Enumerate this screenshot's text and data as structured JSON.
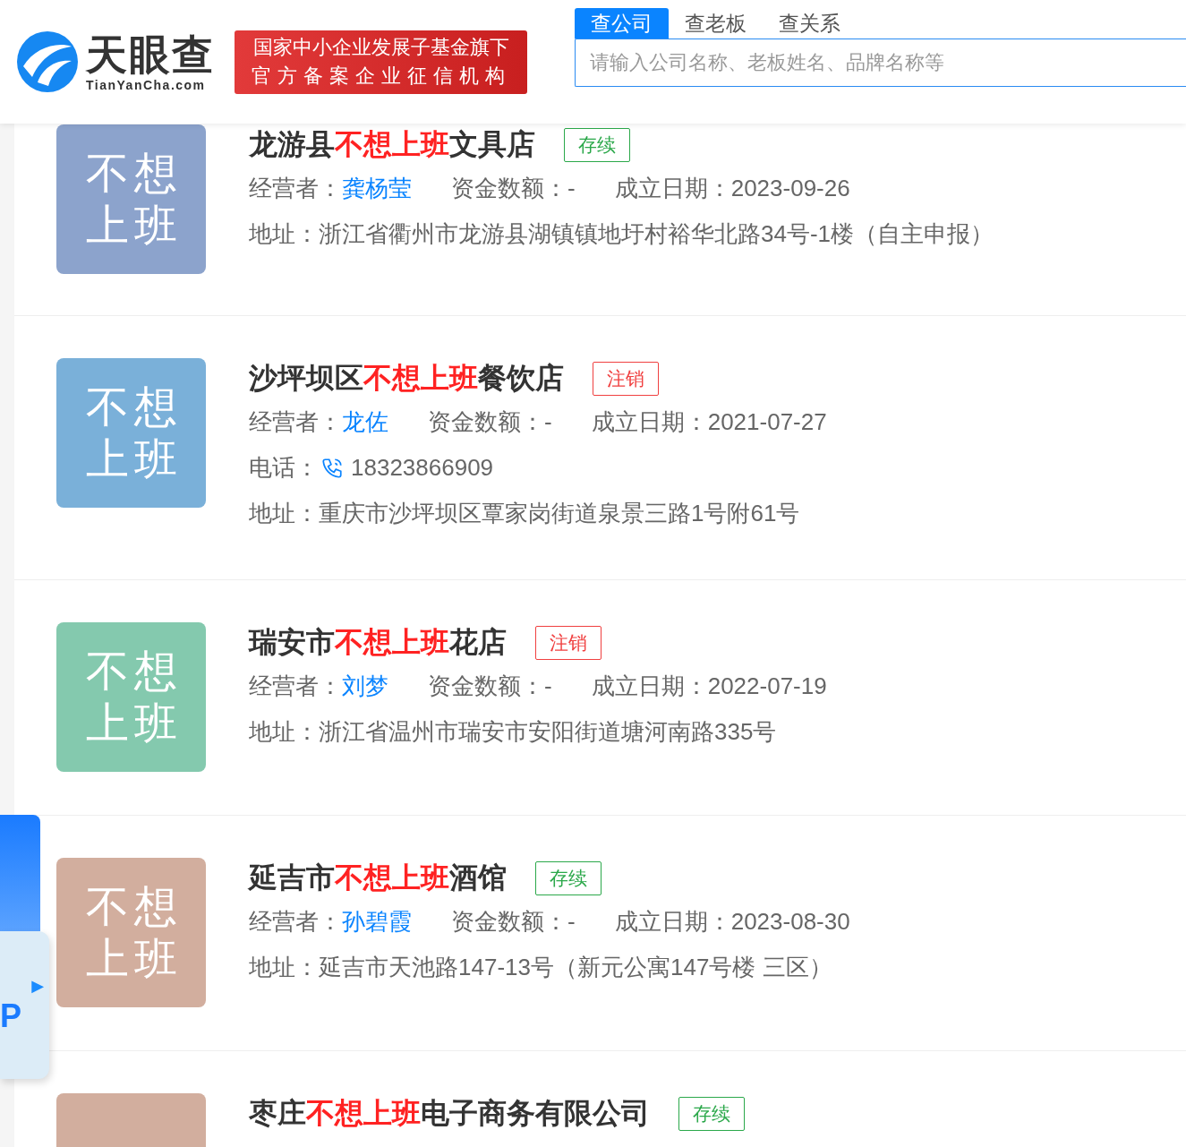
{
  "header": {
    "brand": "天眼查",
    "domain": "TianYanCha.com",
    "badge_lines": [
      "国家中小企业发展子基金旗下",
      "官方备案企业征信机构"
    ],
    "search_tabs": [
      {
        "label": "查公司",
        "selected": true
      },
      {
        "label": "查老板",
        "selected": false
      },
      {
        "label": "查关系",
        "selected": false
      }
    ],
    "search": {
      "placeholder": "请输入公司名称、老板姓名、品牌名称等"
    }
  },
  "results": [
    {
      "logo": [
        "不想",
        "上班"
      ],
      "color": "#8ca3cc",
      "name_prefix": "龙游县",
      "name_highlight": "不想上班",
      "name_suffix": "文具店",
      "status": {
        "label": "存续",
        "kind": "active"
      },
      "fields": [
        {
          "label": "经营者：",
          "value": "龚杨莹",
          "kind": "link"
        },
        {
          "label": "资金数额：",
          "value": "-",
          "kind": "plain"
        },
        {
          "label": "成立日期：",
          "value": "2023-09-26",
          "kind": "plain"
        }
      ],
      "lines": [
        {
          "label": "地址：",
          "value": "浙江省衢州市龙游县湖镇镇地圩村裕华北路34号-1楼（自主申报）",
          "kind": "address"
        }
      ]
    },
    {
      "logo": [
        "不想",
        "上班"
      ],
      "color": "#7ab0d9",
      "name_prefix": "沙坪坝区",
      "name_highlight": "不想上班",
      "name_suffix": "餐饮店",
      "status": {
        "label": "注销",
        "kind": "cancelled"
      },
      "fields": [
        {
          "label": "经营者：",
          "value": "龙佐",
          "kind": "link"
        },
        {
          "label": "资金数额：",
          "value": "-",
          "kind": "plain"
        },
        {
          "label": "成立日期：",
          "value": "2021-07-27",
          "kind": "plain"
        }
      ],
      "lines": [
        {
          "label": "电话：",
          "value": "18323866909",
          "kind": "phone"
        },
        {
          "label": "地址：",
          "value": "重庆市沙坪坝区覃家岗街道泉景三路1号附61号",
          "kind": "address"
        }
      ]
    },
    {
      "logo": [
        "不想",
        "上班"
      ],
      "color": "#84c9ae",
      "name_prefix": "瑞安市",
      "name_highlight": "不想上班",
      "name_suffix": "花店",
      "status": {
        "label": "注销",
        "kind": "cancelled"
      },
      "fields": [
        {
          "label": "经营者：",
          "value": "刘梦",
          "kind": "link"
        },
        {
          "label": "资金数额：",
          "value": "-",
          "kind": "plain"
        },
        {
          "label": "成立日期：",
          "value": "2022-07-19",
          "kind": "plain"
        }
      ],
      "lines": [
        {
          "label": "地址：",
          "value": "浙江省温州市瑞安市安阳街道塘河南路335号",
          "kind": "address"
        }
      ]
    },
    {
      "logo": [
        "不想",
        "上班"
      ],
      "color": "#d2ae9e",
      "name_prefix": "延吉市",
      "name_highlight": "不想上班",
      "name_suffix": "酒馆",
      "status": {
        "label": "存续",
        "kind": "active"
      },
      "fields": [
        {
          "label": "经营者：",
          "value": "孙碧霞",
          "kind": "link"
        },
        {
          "label": "资金数额：",
          "value": "-",
          "kind": "plain"
        },
        {
          "label": "成立日期：",
          "value": "2023-08-30",
          "kind": "plain"
        }
      ],
      "lines": [
        {
          "label": "地址：",
          "value": "延吉市天池路147-13号（新元公寓147号楼 三区）",
          "kind": "address"
        }
      ]
    },
    {
      "color": "#d2ae9e",
      "name_prefix": "枣庄",
      "name_highlight": "不想上班",
      "name_suffix": "电子商务有限公司",
      "status": {
        "label": "存续",
        "kind": "active"
      }
    }
  ],
  "float_widget": {
    "arrow": "▶",
    "text": "P"
  }
}
